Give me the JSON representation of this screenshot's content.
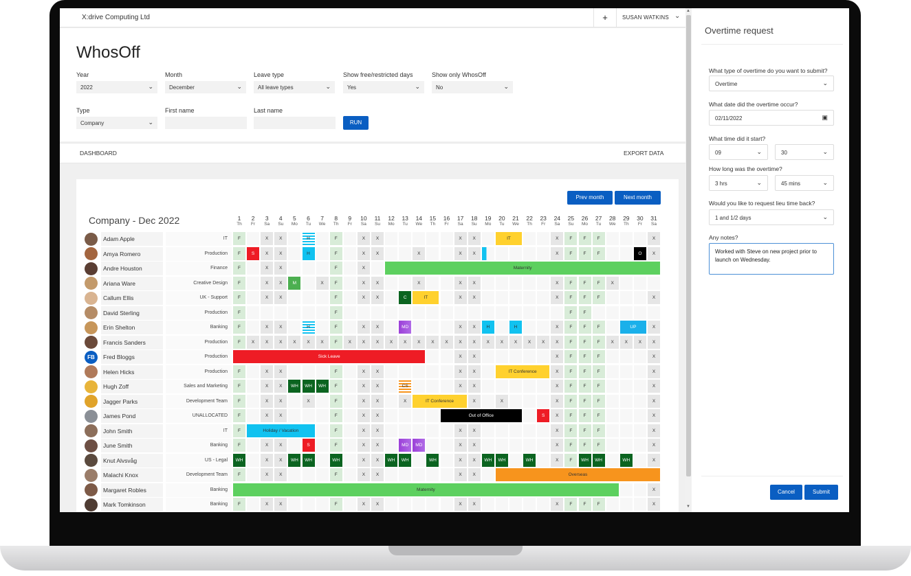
{
  "app": {
    "company_name": "X:drive Computing Ltd",
    "plus_label": "+",
    "user_name": "SUSAN WATKINS",
    "title": "WhosOff"
  },
  "filters": {
    "year": {
      "label": "Year",
      "value": "2022"
    },
    "month": {
      "label": "Month",
      "value": "December"
    },
    "leave_type": {
      "label": "Leave type",
      "value": "All leave types"
    },
    "show_free": {
      "label": "Show free/restricted days",
      "value": "Yes"
    },
    "show_only": {
      "label": "Show only WhosOff",
      "value": "No"
    },
    "type": {
      "label": "Type",
      "value": "Company"
    },
    "first_name": {
      "label": "First name",
      "value": ""
    },
    "last_name": {
      "label": "Last name",
      "value": ""
    },
    "run_label": "RUN"
  },
  "nav": {
    "dashboard": "DASHBOARD",
    "export": "EXPORT DATA"
  },
  "calendar": {
    "title": "Company - Dec 2022",
    "prev_label": "Prev month",
    "next_label": "Next month",
    "days": [
      "1",
      "2",
      "3",
      "4",
      "5",
      "6",
      "7",
      "8",
      "9",
      "10",
      "11",
      "12",
      "13",
      "14",
      "15",
      "16",
      "17",
      "18",
      "19",
      "20",
      "21",
      "22",
      "23",
      "24",
      "25",
      "26",
      "27",
      "28",
      "29",
      "30",
      "31"
    ],
    "weekdays": [
      "Th",
      "Fr",
      "Sa",
      "Su",
      "Mo",
      "Tu",
      "We",
      "Th",
      "Fr",
      "Sa",
      "Su",
      "Mo",
      "Tu",
      "We",
      "Th",
      "Fr",
      "Sa",
      "Su",
      "Mo",
      "Tu",
      "We",
      "Th",
      "Fr",
      "Sa",
      "Su",
      "Mo",
      "Tu",
      "We",
      "Th",
      "Fr",
      "Sa"
    ],
    "colors": {
      "sick": "#ee1c25",
      "maternity": "#5dd05f",
      "it": "#ffd12e",
      "holiday": "#11c2f0",
      "out_of_office": "#000000",
      "overseas": "#f7941d",
      "medical": "#9b3fd8",
      "working_home": "#0b6420",
      "course": "#0b6420",
      "meeting": "#4caf50",
      "unpaid": "#1ab0ea"
    },
    "employees": [
      {
        "name": "Adam Apple",
        "dept": "IT",
        "avatar_color": "#7a5b48",
        "cells": [
          "F",
          "",
          "X",
          "X",
          "",
          "H~",
          "",
          "F",
          "",
          "X",
          "X",
          "",
          "",
          "",
          "",
          "",
          "X",
          "X",
          "",
          "",
          "",
          "",
          "",
          "X",
          "F",
          "F",
          "F",
          "",
          "",
          "",
          "X"
        ],
        "events": [
          {
            "label": "IT",
            "start": 20,
            "end": 21,
            "color": "#ffd12e",
            "text_color": "#333"
          }
        ]
      },
      {
        "name": "Amya Romero",
        "dept": "Production",
        "avatar_color": "#a3653f",
        "cells": [
          "F",
          "S",
          "X",
          "X",
          "",
          "H",
          "",
          "F",
          "",
          "X",
          "X",
          "",
          "",
          "X",
          "",
          "",
          "X",
          "X",
          "h",
          "",
          "",
          "",
          "",
          "X",
          "F",
          "F",
          "F",
          "",
          "",
          "O",
          "X"
        ],
        "events": []
      },
      {
        "name": "Andre Houston",
        "dept": "Finance",
        "avatar_color": "#5a3e33",
        "cells": [
          "F",
          "",
          "X",
          "X",
          "",
          "",
          "",
          "F",
          "",
          "X",
          "",
          "",
          "",
          "",
          "",
          "",
          "",
          "",
          "",
          "",
          "",
          "",
          "",
          "",
          "",
          "",
          "",
          "",
          "",
          "",
          ""
        ],
        "events": [
          {
            "label": "Maternity",
            "start": 12,
            "end": 31,
            "color": "#5dd05f",
            "text_color": "#333"
          }
        ]
      },
      {
        "name": "Ariana Ware",
        "dept": "Creative Design",
        "avatar_color": "#c39a6b",
        "cells": [
          "F",
          "",
          "X",
          "X",
          "M",
          "",
          "X",
          "F",
          "",
          "X",
          "X",
          "",
          "",
          "X",
          "",
          "",
          "X",
          "X",
          "",
          "",
          "",
          "",
          "",
          "X",
          "F",
          "F",
          "F",
          "X",
          "",
          "",
          ""
        ],
        "events": []
      },
      {
        "name": "Callum Ellis",
        "dept": "UK - Support",
        "avatar_color": "#d9b491",
        "cells": [
          "F",
          "",
          "X",
          "X",
          "",
          "",
          "",
          "F",
          "",
          "X",
          "X",
          "",
          "C",
          "",
          "",
          "",
          "X",
          "X",
          "",
          "",
          "",
          "",
          "",
          "X",
          "F",
          "F",
          "F",
          "",
          "",
          "",
          "X"
        ],
        "events": [
          {
            "label": "IT",
            "start": 14,
            "end": 15,
            "color": "#ffd12e",
            "text_color": "#333"
          }
        ]
      },
      {
        "name": "David Sterling",
        "dept": "Production",
        "avatar_color": "#b58c66",
        "cells": [
          "F",
          "",
          "",
          "",
          "",
          "",
          "",
          "F",
          "",
          "",
          "",
          "",
          "",
          "",
          "",
          "",
          "",
          "",
          "",
          "",
          "",
          "",
          "",
          "",
          "F",
          "F",
          "",
          "",
          "",
          "",
          ""
        ],
        "events": []
      },
      {
        "name": "Erin Shelton",
        "dept": "Banking",
        "avatar_color": "#c7965a",
        "cells": [
          "F",
          "",
          "X",
          "X",
          "",
          "H~",
          "",
          "F",
          "",
          "X",
          "X",
          "",
          "MD",
          "",
          "",
          "",
          "X",
          "X",
          "H",
          "",
          "H",
          "",
          "",
          "X",
          "F",
          "F",
          "F",
          "",
          "",
          "",
          "X"
        ],
        "events": [
          {
            "label": "UP",
            "start": 29,
            "end": 30,
            "color": "#1ab0ea",
            "text_color": "#fff"
          }
        ]
      },
      {
        "name": "Francis Sanders",
        "dept": "Production",
        "avatar_color": "#6b4a3a",
        "cells": [
          "F",
          "X",
          "X",
          "X",
          "X",
          "X",
          "X",
          "F",
          "X",
          "X",
          "X",
          "X",
          "X",
          "X",
          "X",
          "X",
          "X",
          "X",
          "X",
          "X",
          "X",
          "X",
          "X",
          "X",
          "F",
          "F",
          "F",
          "X",
          "X",
          "X",
          "X"
        ],
        "events": []
      },
      {
        "name": "Fred Bloggs",
        "dept": "Production",
        "avatar_color": "#0a5ec2",
        "initials": "FB",
        "cells": [
          "",
          "",
          "",
          "",
          "",
          "",
          "",
          "",
          "",
          "",
          "",
          "",
          "",
          "",
          "",
          "",
          "X",
          "X",
          "",
          "",
          "",
          "",
          "",
          "X",
          "F",
          "F",
          "F",
          "",
          "",
          "",
          "X"
        ],
        "events": [
          {
            "label": "Sick Leave",
            "start": 1,
            "end": 14,
            "color": "#ee1c25",
            "text_color": "#fff"
          }
        ]
      },
      {
        "name": "Helen Hicks",
        "dept": "Production",
        "avatar_color": "#b07a5a",
        "cells": [
          "F",
          "",
          "X",
          "X",
          "",
          "",
          "",
          "F",
          "",
          "X",
          "X",
          "",
          "",
          "",
          "",
          "",
          "X",
          "X",
          "",
          "",
          "",
          "",
          "",
          "X",
          "F",
          "F",
          "F",
          "",
          "",
          "",
          "X"
        ],
        "events": [
          {
            "label": "IT Conference",
            "start": 20,
            "end": 23,
            "color": "#ffd12e",
            "text_color": "#333"
          }
        ]
      },
      {
        "name": "Hugh Zoff",
        "dept": "Sales and Marketing",
        "avatar_color": "#e8b43a",
        "cells": [
          "F",
          "",
          "X",
          "X",
          "WH",
          "WH",
          "WH",
          "F",
          "",
          "X",
          "X",
          "",
          "CS~",
          "",
          "",
          "",
          "X",
          "X",
          "",
          "",
          "",
          "",
          "",
          "X",
          "F",
          "F",
          "F",
          "",
          "",
          "",
          "X"
        ],
        "events": []
      },
      {
        "name": "Jagger Parks",
        "dept": "Development Team",
        "avatar_color": "#e0a32a",
        "cells": [
          "F",
          "",
          "X",
          "X",
          "",
          "X",
          "",
          "F",
          "",
          "X",
          "X",
          "",
          "X",
          "",
          "",
          "",
          "",
          "X",
          "",
          "X",
          "",
          "",
          "",
          "X",
          "F",
          "F",
          "F",
          "",
          "",
          "",
          "X"
        ],
        "events": [
          {
            "label": "IT Conference",
            "start": 14,
            "end": 17,
            "color": "#ffd12e",
            "text_color": "#333"
          }
        ]
      },
      {
        "name": "James Pond",
        "dept": "UNALLOCATED",
        "avatar_color": "#8a8f96",
        "cells": [
          "F",
          "",
          "X",
          "X",
          "",
          "",
          "",
          "F",
          "",
          "X",
          "X",
          "",
          "",
          "",
          "",
          "",
          "",
          "",
          "",
          "",
          "",
          "",
          "S",
          "X",
          "F",
          "F",
          "F",
          "",
          "",
          "",
          "X"
        ],
        "events": [
          {
            "label": "Out of Office",
            "start": 16,
            "end": 21,
            "color": "#000000",
            "text_color": "#fff"
          }
        ]
      },
      {
        "name": "John Smith",
        "dept": "IT",
        "avatar_color": "#8c6e5a",
        "cells": [
          "F",
          "",
          "",
          "",
          "",
          "",
          "",
          "F",
          "",
          "X",
          "X",
          "",
          "",
          "",
          "",
          "",
          "X",
          "X",
          "",
          "",
          "",
          "",
          "",
          "X",
          "F",
          "F",
          "F",
          "",
          "",
          "",
          "X"
        ],
        "events": [
          {
            "label": "Holiday / Vacation",
            "start": 2,
            "end": 6,
            "color": "#11c2f0",
            "text_color": "#333"
          }
        ]
      },
      {
        "name": "June Smith",
        "dept": "Banking",
        "avatar_color": "#6d4f44",
        "cells": [
          "F",
          "",
          "X",
          "X",
          "",
          "S",
          "",
          "F",
          "",
          "X",
          "X",
          "",
          "MD",
          "MD",
          "",
          "",
          "X",
          "X",
          "",
          "",
          "",
          "",
          "",
          "X",
          "F",
          "F",
          "F",
          "",
          "",
          "",
          "X"
        ],
        "events": []
      },
      {
        "name": "Knut Alvsvåg",
        "dept": "US - Legal",
        "avatar_color": "#5b4a3e",
        "cells": [
          "WH",
          "",
          "X",
          "X",
          "WH",
          "WH",
          "",
          "WH",
          "",
          "X",
          "X",
          "WH",
          "WH",
          "",
          "WH",
          "",
          "X",
          "X",
          "WH",
          "WH",
          "",
          "WH",
          "",
          "X",
          "F",
          "WH",
          "WH",
          "",
          "WH",
          "",
          "X"
        ],
        "events": []
      },
      {
        "name": "Malachi Knox",
        "dept": "Development Team",
        "avatar_color": "#9a7d69",
        "cells": [
          "F",
          "",
          "X",
          "X",
          "",
          "",
          "",
          "F",
          "",
          "X",
          "X",
          "",
          "",
          "",
          "",
          "",
          "X",
          "X",
          "",
          "",
          "",
          "",
          "",
          "",
          "",
          "",
          "",
          "",
          "",
          "",
          ""
        ],
        "events": [
          {
            "label": "Overseas",
            "start": 20,
            "end": 31,
            "color": "#f7941d",
            "text_color": "#333"
          }
        ]
      },
      {
        "name": "Margaret Robles",
        "dept": "Banking",
        "avatar_color": "#7d5a47",
        "cells": [
          "",
          "",
          "",
          "",
          "",
          "",
          "",
          "",
          "",
          "",
          "",
          "",
          "",
          "",
          "",
          "",
          "",
          "",
          "",
          "",
          "",
          "",
          "",
          "",
          "",
          "",
          "",
          "",
          "",
          "",
          "X"
        ],
        "events": [
          {
            "label": "Maternity",
            "start": 1,
            "end": 28,
            "color": "#5dd05f",
            "text_color": "#333"
          }
        ]
      },
      {
        "name": "Mark Tomkinson",
        "dept": "Banking",
        "avatar_color": "#4f3c33",
        "cells": [
          "F",
          "",
          "X",
          "X",
          "",
          "",
          "",
          "F",
          "",
          "X",
          "X",
          "",
          "",
          "",
          "",
          "",
          "X",
          "X",
          "",
          "",
          "",
          "",
          "",
          "X",
          "F",
          "F",
          "F",
          "",
          "",
          "",
          "X"
        ],
        "events": []
      }
    ]
  },
  "panel": {
    "title": "Overtime request",
    "q_type": {
      "label": "What type of overtime do you want to submit?",
      "value": "Overtime"
    },
    "q_date": {
      "label": "What date did the overtime occur?",
      "value": "02/11/2022"
    },
    "q_time": {
      "label": "What time did it start?",
      "hour": "09",
      "minute": "30"
    },
    "q_length": {
      "label": "How long was the overtime?",
      "hours": "3 hrs",
      "minutes": "45 mins"
    },
    "q_lieu": {
      "label": "Would you like to request lieu time back?",
      "value": "1 and 1/2 days"
    },
    "q_notes": {
      "label": "Any notes?",
      "value": "Worked with Steve on new project prior to launch on Wednesday."
    },
    "cancel_label": "Cancel",
    "submit_label": "Submit"
  }
}
